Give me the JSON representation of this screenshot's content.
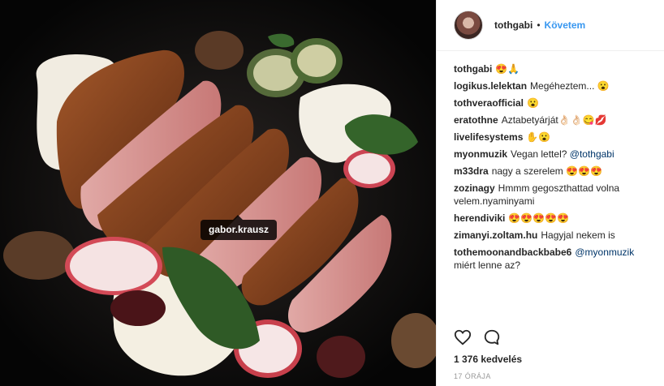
{
  "photo": {
    "tag": "gabor.krausz"
  },
  "header": {
    "username": "tothgabi",
    "separator": "•",
    "follow_label": "Követem"
  },
  "comments": [
    {
      "author": "tothgabi",
      "text": "😍🙏",
      "mention": ""
    },
    {
      "author": "logikus.lelektan",
      "text": "Megéheztem... 😮",
      "mention": ""
    },
    {
      "author": "tothveraofficial",
      "text": "😮",
      "mention": ""
    },
    {
      "author": "eratothne",
      "text": "Aztabetyárját👌🏻👌🏻😋💋",
      "mention": ""
    },
    {
      "author": "livelifesystems",
      "text": "✋😮",
      "mention": ""
    },
    {
      "author": "myonmuzik",
      "text": "Vegan lettel?",
      "mention": "@tothgabi"
    },
    {
      "author": "m33dra",
      "text": "nagy a szerelem 😍😍😍",
      "mention": ""
    },
    {
      "author": "zozinagy",
      "text": "Hmmm gegoszthattad volna velem.nyaminyami",
      "mention": ""
    },
    {
      "author": "herendiviki",
      "text": "😍😍😍😍😍",
      "mention": ""
    },
    {
      "author": "zimanyi.zoltam.hu",
      "text": "Hagyjal nekem is",
      "mention": ""
    },
    {
      "author": "tothemoonandbackbabe6",
      "text": "miért lenne az?",
      "mention": "@myonmuzik",
      "mention_first": true
    }
  ],
  "actions": {
    "like_icon": "heart-outline-icon",
    "comment_icon": "speech-bubble-icon"
  },
  "likes": "1 376 kedvelés",
  "timestamp": "17 órája",
  "colors": {
    "follow": "#3897f0",
    "mention": "#003569",
    "timestamp": "#999999"
  }
}
